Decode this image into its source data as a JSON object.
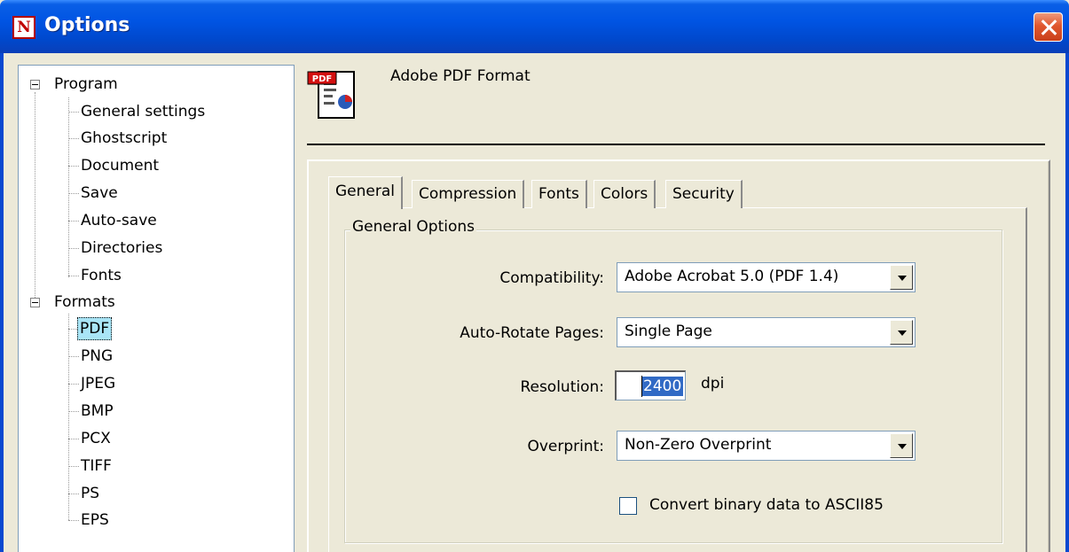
{
  "window": {
    "title": "Options",
    "app_icon": "N"
  },
  "tree": {
    "groups": [
      {
        "label": "Program",
        "children": [
          "General settings",
          "Ghostscript",
          "Document",
          "Save",
          "Auto-save",
          "Directories",
          "Fonts"
        ]
      },
      {
        "label": "Formats",
        "children": [
          "PDF",
          "PNG",
          "JPEG",
          "BMP",
          "PCX",
          "TIFF",
          "PS",
          "EPS"
        ],
        "selected": "PDF"
      }
    ]
  },
  "header": {
    "title": "Adobe PDF Format",
    "icon": "pdf-document-icon",
    "icon_badge": "PDF"
  },
  "tabs": [
    "General",
    "Compression",
    "Fonts",
    "Colors",
    "Security"
  ],
  "active_tab": "General",
  "general_options": {
    "group_label": "General Options",
    "compatibility": {
      "label": "Compatibility:",
      "value": "Adobe Acrobat 5.0 (PDF 1.4)"
    },
    "auto_rotate": {
      "label": "Auto-Rotate Pages:",
      "value": "Single Page"
    },
    "resolution": {
      "label": "Resolution:",
      "value": "2400",
      "unit": "dpi"
    },
    "overprint": {
      "label": "Overprint:",
      "value": "Non-Zero Overprint"
    },
    "ascii85": {
      "label": "Convert binary data to ASCII85",
      "checked": false
    }
  }
}
